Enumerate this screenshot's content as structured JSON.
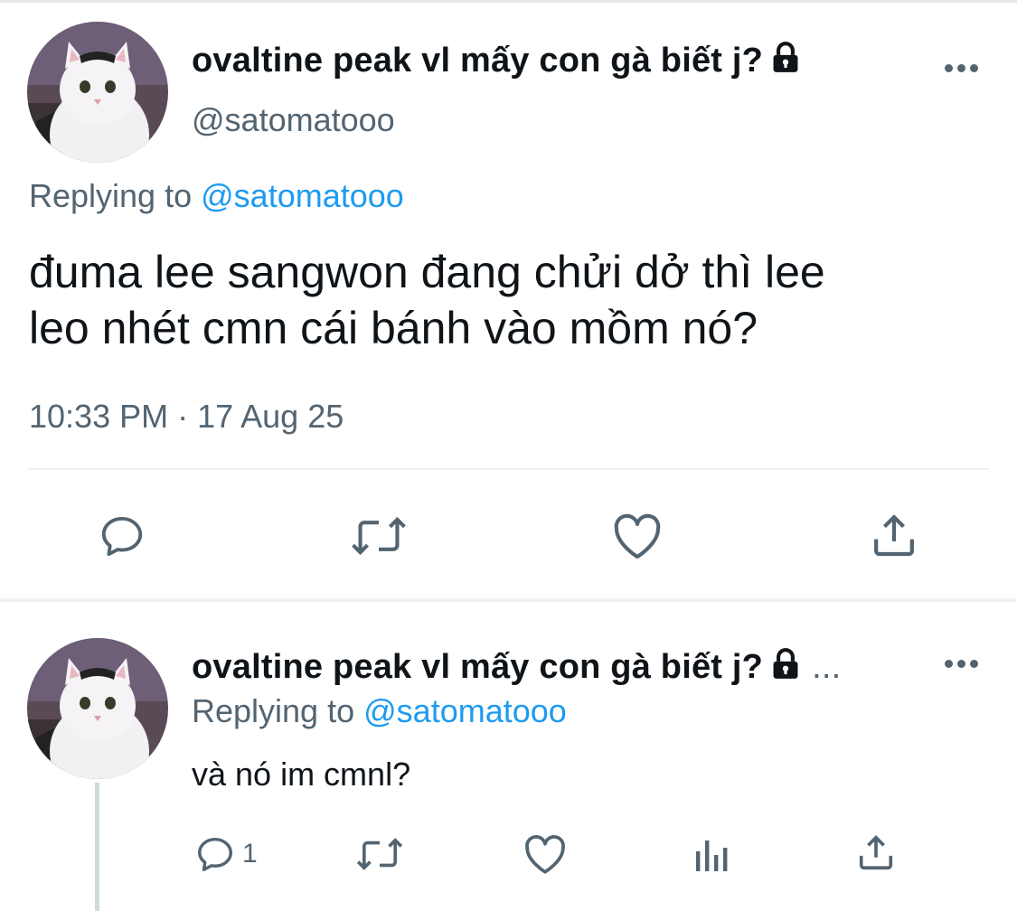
{
  "tweet": {
    "display_name": "ovaltine peak vl mấy con gà biết j?",
    "handle": "@satomatooo",
    "replying_prefix": "Replying to",
    "replying_to": "@satomatooo",
    "text_line1": "đuma lee sangwon đang chửi dở thì lee",
    "text_line2": "leo nhét cmn cái bánh vào mồm nó?",
    "timestamp": "10:33 PM · 17 Aug 25",
    "avatar_icon": "cat-avatar-icon",
    "more_icon": "more-options-icon",
    "actions": [
      "reply-icon",
      "retweet-icon",
      "like-icon",
      "share-icon"
    ]
  },
  "reply": {
    "display_name": "ovaltine peak vl mấy con gà biết j?",
    "truncation": "...",
    "replying_prefix": "Replying to",
    "replying_to": "@satomatooo",
    "text": "và nó im cmnl?",
    "reply_count": "1",
    "actions": [
      "reply-icon",
      "retweet-icon",
      "like-icon",
      "views-icon",
      "share-icon"
    ]
  },
  "colors": {
    "text": "#0f1419",
    "secondary": "#536471",
    "link": "#1d9bf0",
    "divider": "#eff3f4"
  }
}
